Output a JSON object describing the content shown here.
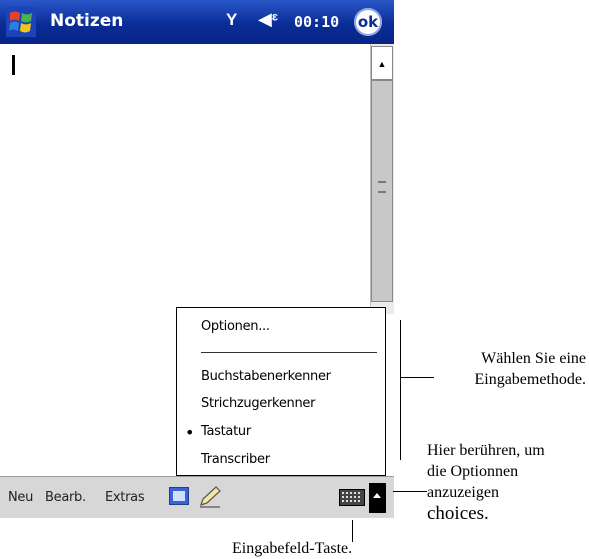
{
  "title_bar": {
    "app_title": "Notizen",
    "clock": "00:10",
    "ok_label": "ok",
    "signal_icon": "antenna-icon",
    "volume_icon": "speaker-icon",
    "start_icon": "windows-flag-icon"
  },
  "popup_menu": {
    "items": [
      {
        "label": "Optionen..."
      },
      {
        "label": "Buchstabenerkenner"
      },
      {
        "label": "Strichzugerkenner"
      },
      {
        "label": "Tastatur",
        "selected": true
      },
      {
        "label": "Transcriber"
      }
    ]
  },
  "toolbar": {
    "menus": [
      "Neu",
      "Bearb.",
      "Extras"
    ],
    "recorder_icon": "recorder-icon",
    "pen_icon": "pen-icon",
    "keyboard_icon": "keyboard-icon",
    "input_arrow_icon": "up-arrow-icon"
  },
  "annotations": {
    "select_method": [
      "Wählen Sie eine",
      "Eingabemethode."
    ],
    "tap_options": [
      "Hier berühren, um",
      "die Optionnen",
      "anzuzeigen",
      "choices."
    ],
    "input_panel": "Eingabefeld-Taste."
  },
  "colors": {
    "title_bar": "#0a2c96",
    "toolbar": "#d7d7d7"
  }
}
